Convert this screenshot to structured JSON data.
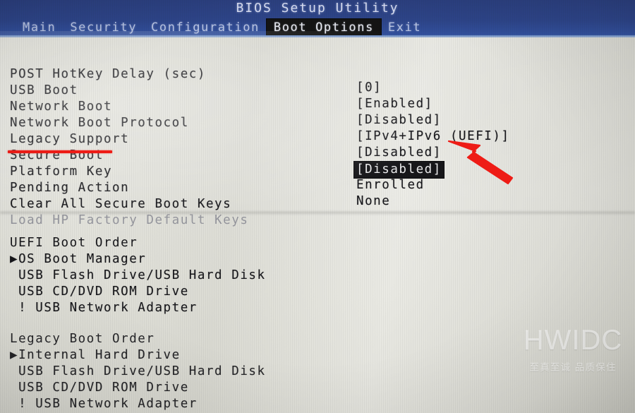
{
  "header": {
    "title": "BIOS Setup Utility",
    "menu": [
      {
        "label": "Main",
        "active": false
      },
      {
        "label": "Security",
        "active": false
      },
      {
        "label": "Configuration",
        "active": false
      },
      {
        "label": "Boot Options",
        "active": true
      },
      {
        "label": "Exit",
        "active": false
      }
    ]
  },
  "settings": [
    {
      "label": "POST HotKey Delay (sec)",
      "value": "[0]"
    },
    {
      "label": "USB Boot",
      "value": "[Enabled]"
    },
    {
      "label": "Network Boot",
      "value": "[Disabled]"
    },
    {
      "label": "Network Boot Protocol",
      "value": "[IPv4+IPv6 (UEFI)]"
    },
    {
      "label": "Legacy Support",
      "value": "[Disabled]"
    },
    {
      "label": "Secure Boot",
      "value": "[Disabled]"
    },
    {
      "label": "Platform Key",
      "value": "Enrolled"
    },
    {
      "label": "Pending Action",
      "value": "None"
    },
    {
      "label": "Clear All Secure Boot Keys",
      "value": ""
    },
    {
      "label": "Load HP Factory Default Keys",
      "value": ""
    }
  ],
  "uefi_boot_order": {
    "title": "UEFI Boot Order",
    "entries": [
      "▶OS Boot Manager",
      " USB Flash Drive/USB Hard Disk",
      " USB CD/DVD ROM Drive",
      " ! USB Network Adapter"
    ]
  },
  "legacy_boot_order": {
    "title": "Legacy Boot Order",
    "entries": [
      "▶Internal Hard Drive",
      " USB Flash Drive/USB Hard Disk",
      " USB CD/DVD ROM Drive",
      " ! USB Network Adapter"
    ]
  },
  "watermark": {
    "main": "HWIDC",
    "sub": "至真至诚 品质保住"
  },
  "annotations": {
    "underline_target": "Secure Boot",
    "arrow_target": "[Disabled]",
    "color": "#ee1c16"
  }
}
